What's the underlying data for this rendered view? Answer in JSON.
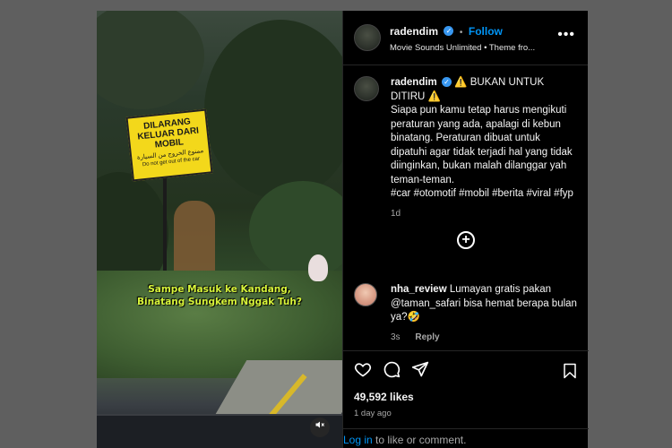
{
  "video": {
    "sign": {
      "line1": "DILARANG",
      "line2": "KELUAR DARI MOBIL",
      "line3": "ممنوع الخروج من السيارة",
      "line4": "Do not get out of the car"
    },
    "caption_line1": "Sampe Masuk ke Kandang,",
    "caption_line2": "Binatang Sungkem Nggak Tuh?",
    "mute_icon": "speaker-muted-icon"
  },
  "header": {
    "username": "radendim",
    "dot": "•",
    "follow_label": "Follow",
    "audio": "Movie Sounds Unlimited • Theme fro...",
    "more": "•••"
  },
  "post": {
    "username": "radendim",
    "title_prefix": "⚠️",
    "title": "BUKAN UNTUK DITIRU",
    "title_suffix": "⚠️",
    "body": "Siapa pun kamu tetap harus mengikuti peraturan yang ada, apalagi di kebun binatang. Peraturan dibuat untuk dipatuhi agar tidak terjadi hal yang tidak diinginkan, bukan malah dilanggar yah teman-teman.",
    "hashtags": "#car #otomotif #mobil #berita #viral #fyp",
    "time": "1d"
  },
  "comment": {
    "username": "nha_review",
    "text": "Lumayan gratis pakan @taman_safari bisa hemat berapa bulan ya?🤣",
    "time": "3s",
    "reply_label": "Reply"
  },
  "footer": {
    "likes": "49,592 likes",
    "ago": "1 day ago",
    "login_link": "Log in",
    "login_rest": " to like or comment."
  },
  "colors": {
    "accent": "#0095f6",
    "background": "#000000",
    "overlay": "#5f5f5f",
    "caption": "#d8f53a",
    "sign": "#f3d81b"
  }
}
